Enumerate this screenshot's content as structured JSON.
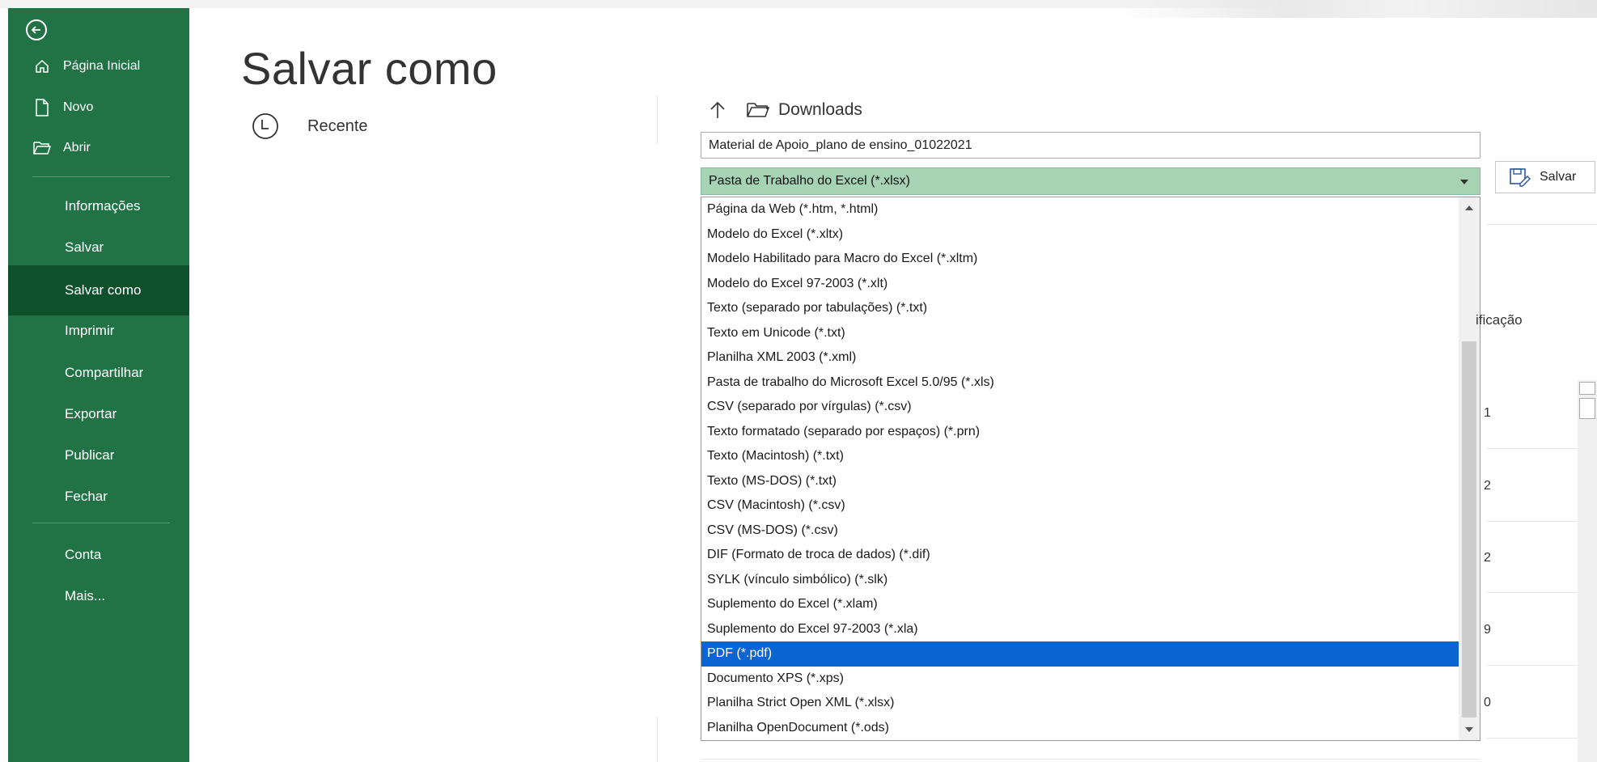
{
  "page": {
    "title": "Salvar como"
  },
  "sidebar": {
    "top_items": [
      {
        "label": "Página Inicial",
        "icon": "home-icon"
      },
      {
        "label": "Novo",
        "icon": "new-file-icon"
      },
      {
        "label": "Abrir",
        "icon": "open-folder-icon"
      }
    ],
    "items": [
      {
        "label": "Informações"
      },
      {
        "label": "Salvar"
      },
      {
        "label": "Salvar como",
        "active": true
      },
      {
        "label": "Imprimir"
      },
      {
        "label": "Compartilhar"
      },
      {
        "label": "Exportar"
      },
      {
        "label": "Publicar"
      },
      {
        "label": "Fechar"
      },
      {
        "label": "Conta"
      },
      {
        "label": "Mais..."
      }
    ],
    "color": "#217346",
    "active_color": "#0e4f2c"
  },
  "locations": {
    "recent_label": "Recente"
  },
  "path": {
    "folder": "Downloads"
  },
  "file": {
    "name": "Material de Apoio_plano de ensino_01022021",
    "selected_type": "Pasta de Trabalho do Excel (*.xlsx)"
  },
  "save_button": {
    "label": "Salvar"
  },
  "dropdown": {
    "options": [
      "Página da Web (*.htm, *.html)",
      "Modelo do Excel (*.xltx)",
      "Modelo Habilitado para Macro do Excel (*.xltm)",
      "Modelo do Excel 97-2003 (*.xlt)",
      "Texto (separado por tabulações) (*.txt)",
      "Texto em Unicode (*.txt)",
      "Planilha XML 2003 (*.xml)",
      "Pasta de trabalho do Microsoft Excel 5.0/95 (*.xls)",
      "CSV (separado por vírgulas) (*.csv)",
      "Texto formatado (separado por espaços) (*.prn)",
      "Texto (Macintosh) (*.txt)",
      "Texto (MS-DOS) (*.txt)",
      "CSV (Macintosh) (*.csv)",
      "CSV (MS-DOS) (*.csv)",
      "DIF (Formato de troca de dados) (*.dif)",
      "SYLK (vínculo simbólico) (*.slk)",
      "Suplemento do Excel (*.xlam)",
      "Suplemento do Excel 97-2003 (*.xla)",
      "PDF (*.pdf)",
      "Documento XPS (*.xps)",
      "Planilha Strict Open XML (*.xlsx)",
      "Planilha OpenDocument (*.ods)"
    ],
    "highlighted": "PDF (*.pdf)",
    "highlight_color": "#0a64d2"
  },
  "background_list": {
    "column_header": "ificação",
    "row_fragments": [
      "1",
      "2",
      "2",
      "9",
      "0"
    ]
  }
}
